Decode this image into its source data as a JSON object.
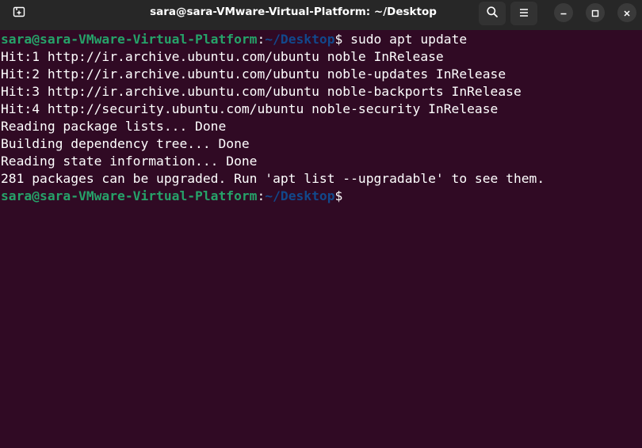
{
  "window": {
    "title": "sara@sara-VMware-Virtual-Platform: ~/Desktop"
  },
  "header": {
    "new_tab_icon": "new-tab-icon",
    "search_icon": "search-icon",
    "menu_icon": "hamburger-menu-icon",
    "minimize_icon": "minimize-icon",
    "maximize_icon": "maximize-icon",
    "close_icon": "close-icon"
  },
  "colors": {
    "terminal_background": "#300a24",
    "headerbar_background": "#272727",
    "prompt_user": "#26a269",
    "prompt_path": "#12488b",
    "text": "#ffffff"
  },
  "terminal": {
    "prompt": {
      "user_host": "sara@sara-VMware-Virtual-Platform",
      "colon": ":",
      "path": "~/Desktop",
      "dollar": "$"
    },
    "command": " sudo apt update",
    "output": [
      "Hit:1 http://ir.archive.ubuntu.com/ubuntu noble InRelease",
      "Hit:2 http://ir.archive.ubuntu.com/ubuntu noble-updates InRelease",
      "Hit:3 http://ir.archive.ubuntu.com/ubuntu noble-backports InRelease",
      "Hit:4 http://security.ubuntu.com/ubuntu noble-security InRelease",
      "Reading package lists... Done",
      "Building dependency tree... Done",
      "Reading state information... Done",
      "281 packages can be upgraded. Run 'apt list --upgradable' to see them."
    ]
  }
}
